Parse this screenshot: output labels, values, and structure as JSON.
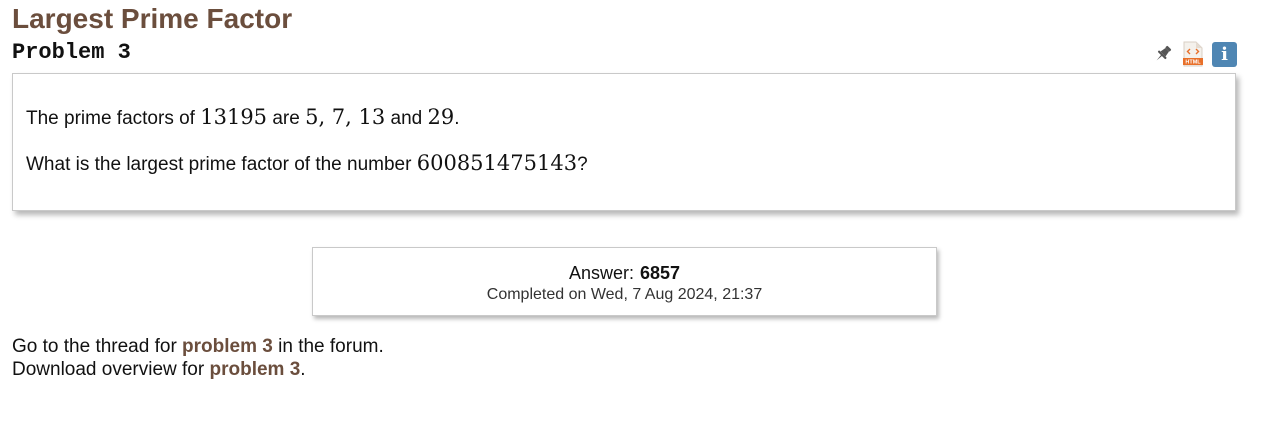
{
  "page": {
    "title": "Largest Prime Factor",
    "subtitle": "Problem 3"
  },
  "toolbar": {
    "icons": [
      "pin-icon",
      "html-file-icon",
      "info-icon"
    ],
    "info_glyph": "i",
    "html_badge": "HTML",
    "info_color": "#4f86b3"
  },
  "problem": {
    "line1": {
      "t1": "The prime factors of ",
      "m1": "13195",
      "t2": " are ",
      "m2": "5, 7, 13",
      "t3": " and ",
      "m3": "29",
      "t4": "."
    },
    "line2": {
      "t1": "What is the largest prime factor of the number ",
      "m1": "600851475143",
      "t2": "?"
    }
  },
  "answer": {
    "label": "Answer:",
    "value": "6857",
    "completed": "Completed on Wed, 7 Aug 2024, 21:37"
  },
  "footer": {
    "thread_prefix": "Go to the thread for ",
    "thread_link": "problem 3",
    "thread_suffix": " in the forum.",
    "download_prefix": "Download overview for ",
    "download_link": "problem 3",
    "download_suffix": "."
  },
  "colors": {
    "brand": "#6b4e3d"
  }
}
